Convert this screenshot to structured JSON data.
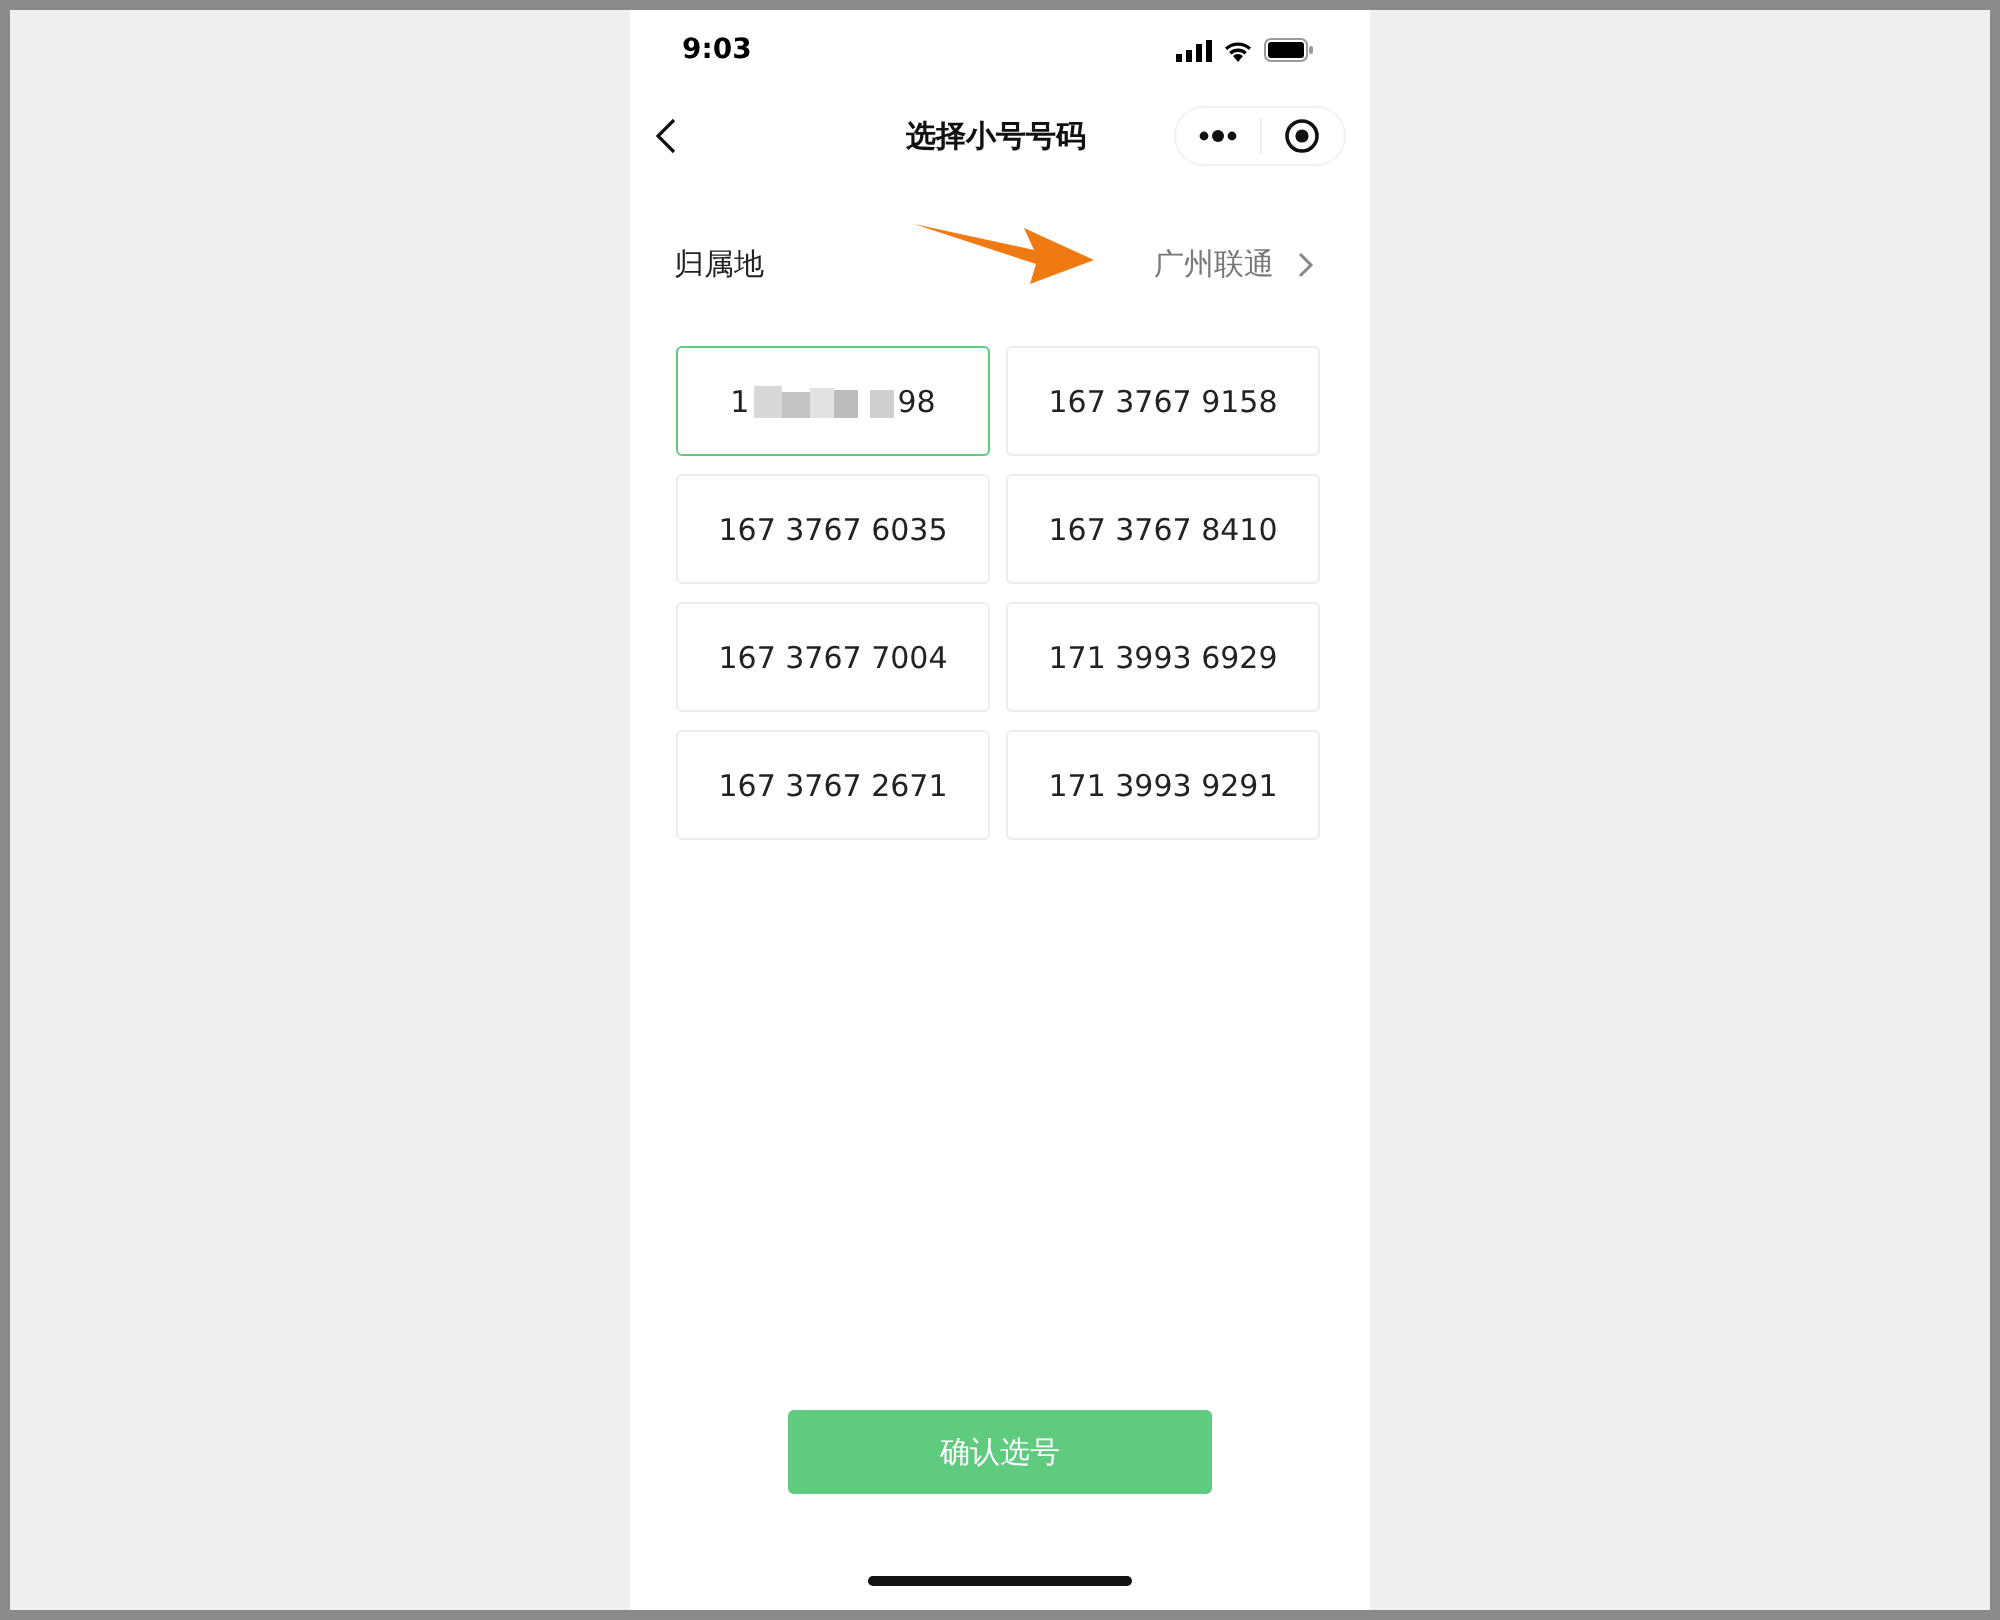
{
  "status_bar": {
    "time": "9:03"
  },
  "nav_bar": {
    "title": "选择小号号码"
  },
  "location": {
    "label": "归属地",
    "value": "广州联通"
  },
  "numbers": [
    {
      "kind": "redacted",
      "start": "1",
      "end": "98",
      "selected": true
    },
    {
      "kind": "plain",
      "number": "167 3767 9158",
      "selected": false
    },
    {
      "kind": "plain",
      "number": "167 3767 6035",
      "selected": false
    },
    {
      "kind": "plain",
      "number": "167 3767 8410",
      "selected": false
    },
    {
      "kind": "plain",
      "number": "167 3767 7004",
      "selected": false
    },
    {
      "kind": "plain",
      "number": "171 3993 6929",
      "selected": false
    },
    {
      "kind": "plain",
      "number": "167 3767 2671",
      "selected": false
    },
    {
      "kind": "plain",
      "number": "171 3993 9291",
      "selected": false
    }
  ],
  "confirm_button": {
    "label": "确认选号"
  }
}
